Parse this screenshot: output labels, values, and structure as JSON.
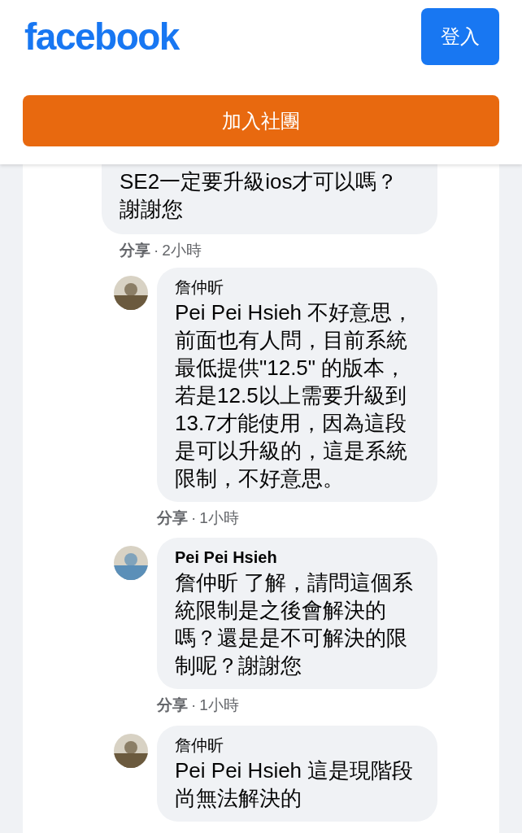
{
  "header": {
    "logo": "facebook",
    "login_button": "登入",
    "join_button": "加入社團"
  },
  "parent_comment": {
    "text": "SE2一定要升級ios才可以嗎？謝謝您",
    "action": "分享",
    "separator": "·",
    "time": "2小時"
  },
  "replies": [
    {
      "author": "詹仲昕",
      "author_bold": false,
      "text": "Pei Pei Hsieh 不好意思，前面也有人問，目前系統最低提供\"12.5\" 的版本，若是12.5以上需要升級到13.7才能使用，因為這段是可以升級的，這是系統限制，不好意思。",
      "action": "分享",
      "separator": "·",
      "time": "1小時"
    },
    {
      "author": "Pei Pei Hsieh",
      "author_bold": true,
      "text": "詹仲昕 了解，請問這個系統限制是之後會解決的嗎？還是是不可解決的限制呢？謝謝您",
      "action": "分享",
      "separator": "·",
      "time": "1小時"
    },
    {
      "author": "詹仲昕",
      "author_bold": false,
      "text": "Pei Pei Hsieh 這是現階段尚無法解決的"
    }
  ]
}
